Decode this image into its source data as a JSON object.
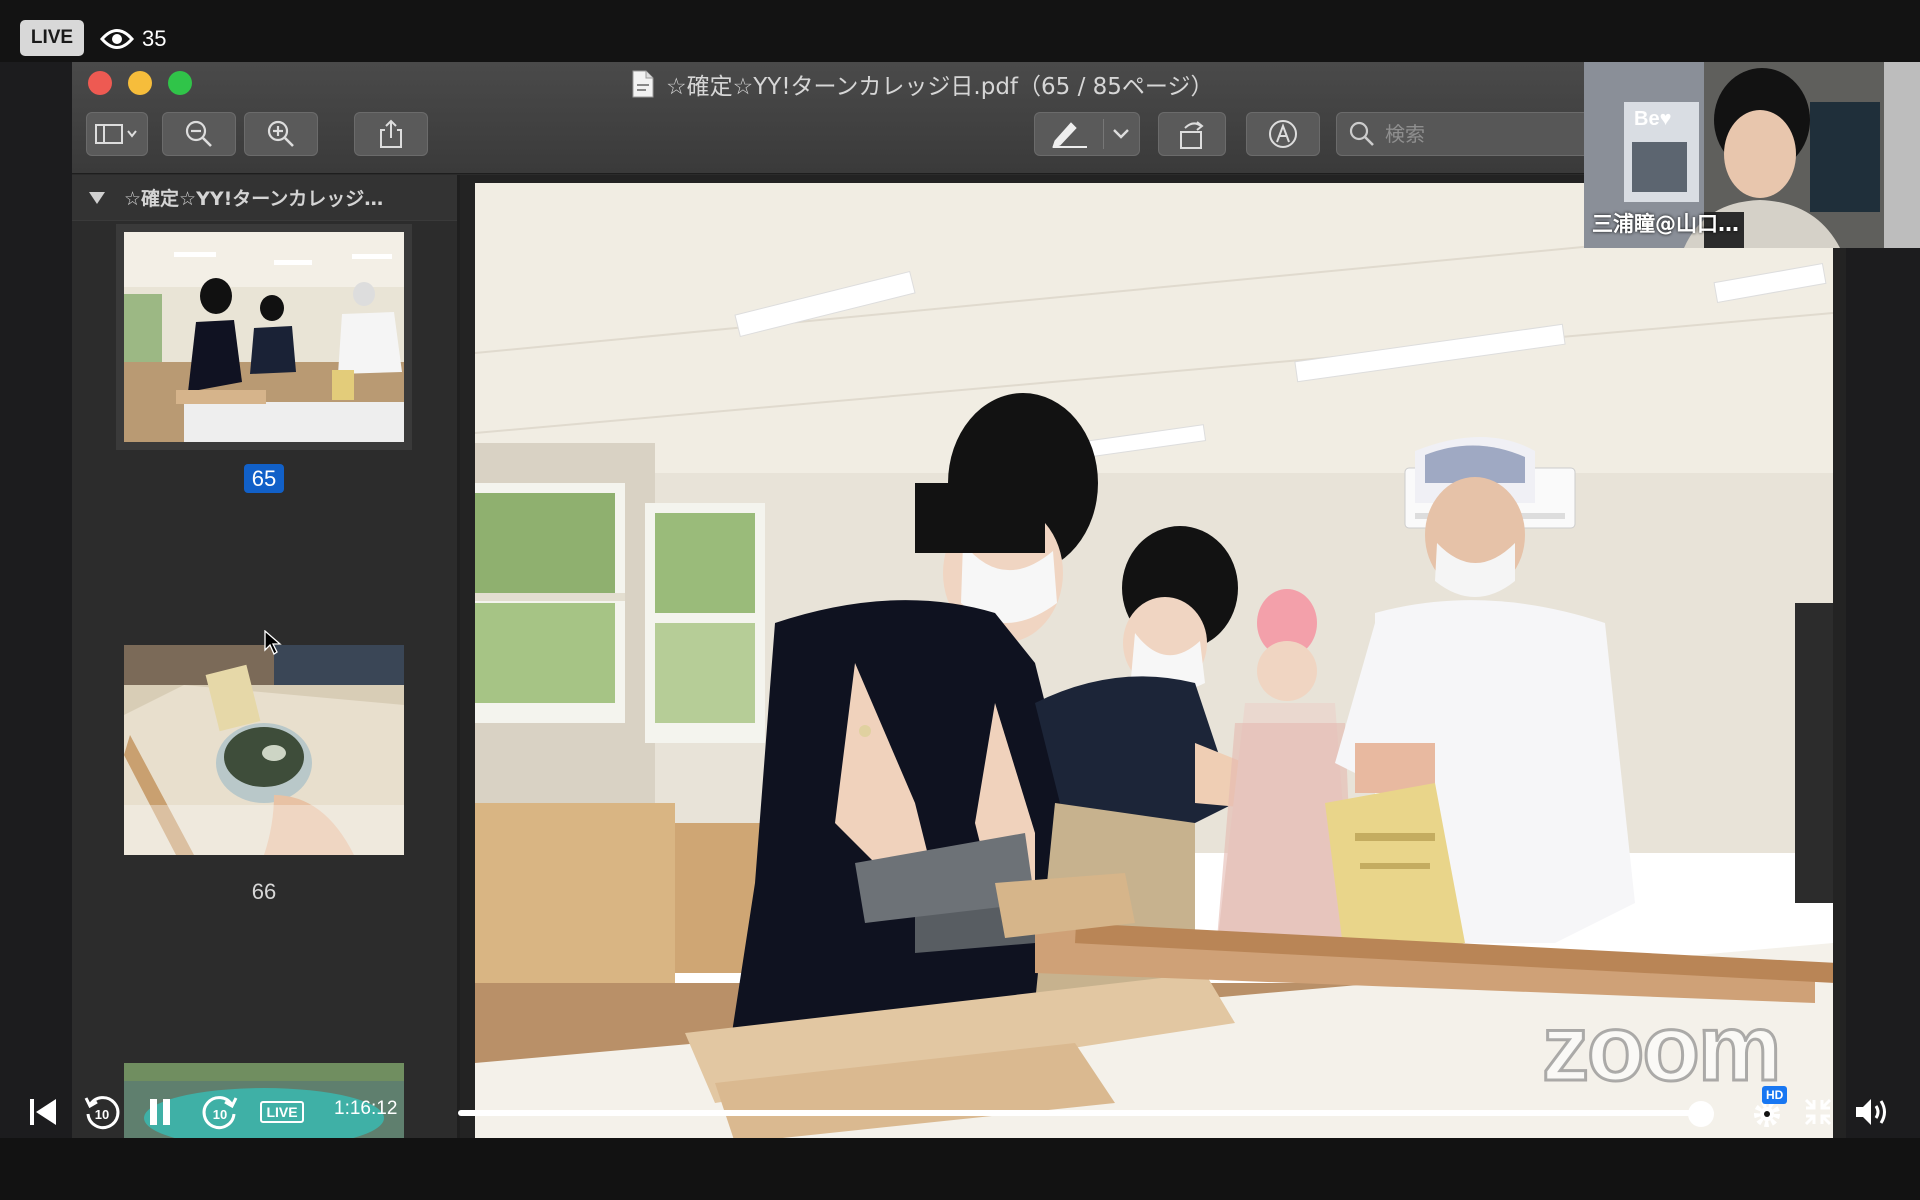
{
  "stream": {
    "live_label": "LIVE",
    "viewer_count": "35",
    "timecode": "1:16:12",
    "live_small_label": "LIVE",
    "hd_label": "HD",
    "progress": 0.99
  },
  "window": {
    "title": "☆確定☆YY!ターンカレッジ⽇.pdf（65 / 85ページ）",
    "search_placeholder": "検索"
  },
  "sidebar": {
    "doc_name": "☆確定☆YY!ターンカレッジ…",
    "pages": [
      {
        "number": "65",
        "selected": true
      },
      {
        "number": "66",
        "selected": false
      }
    ]
  },
  "pip": {
    "participant_name": "三浦瞳@山口…",
    "sign_text": "Be♥"
  },
  "watermark": "zoom",
  "icons": {
    "sidebar_toggle": "sidebar-icon",
    "zoom_out": "zoom-out-icon",
    "zoom_in": "zoom-in-icon",
    "share": "share-icon",
    "markup": "pen-icon",
    "rotate": "rotate-icon",
    "annotate": "markup-circle-icon",
    "search": "search-icon"
  },
  "colors": {
    "selection_blue": "#1160c8",
    "close": "#ee5a52",
    "minimize": "#f6bd3b",
    "maximize": "#30c449"
  }
}
